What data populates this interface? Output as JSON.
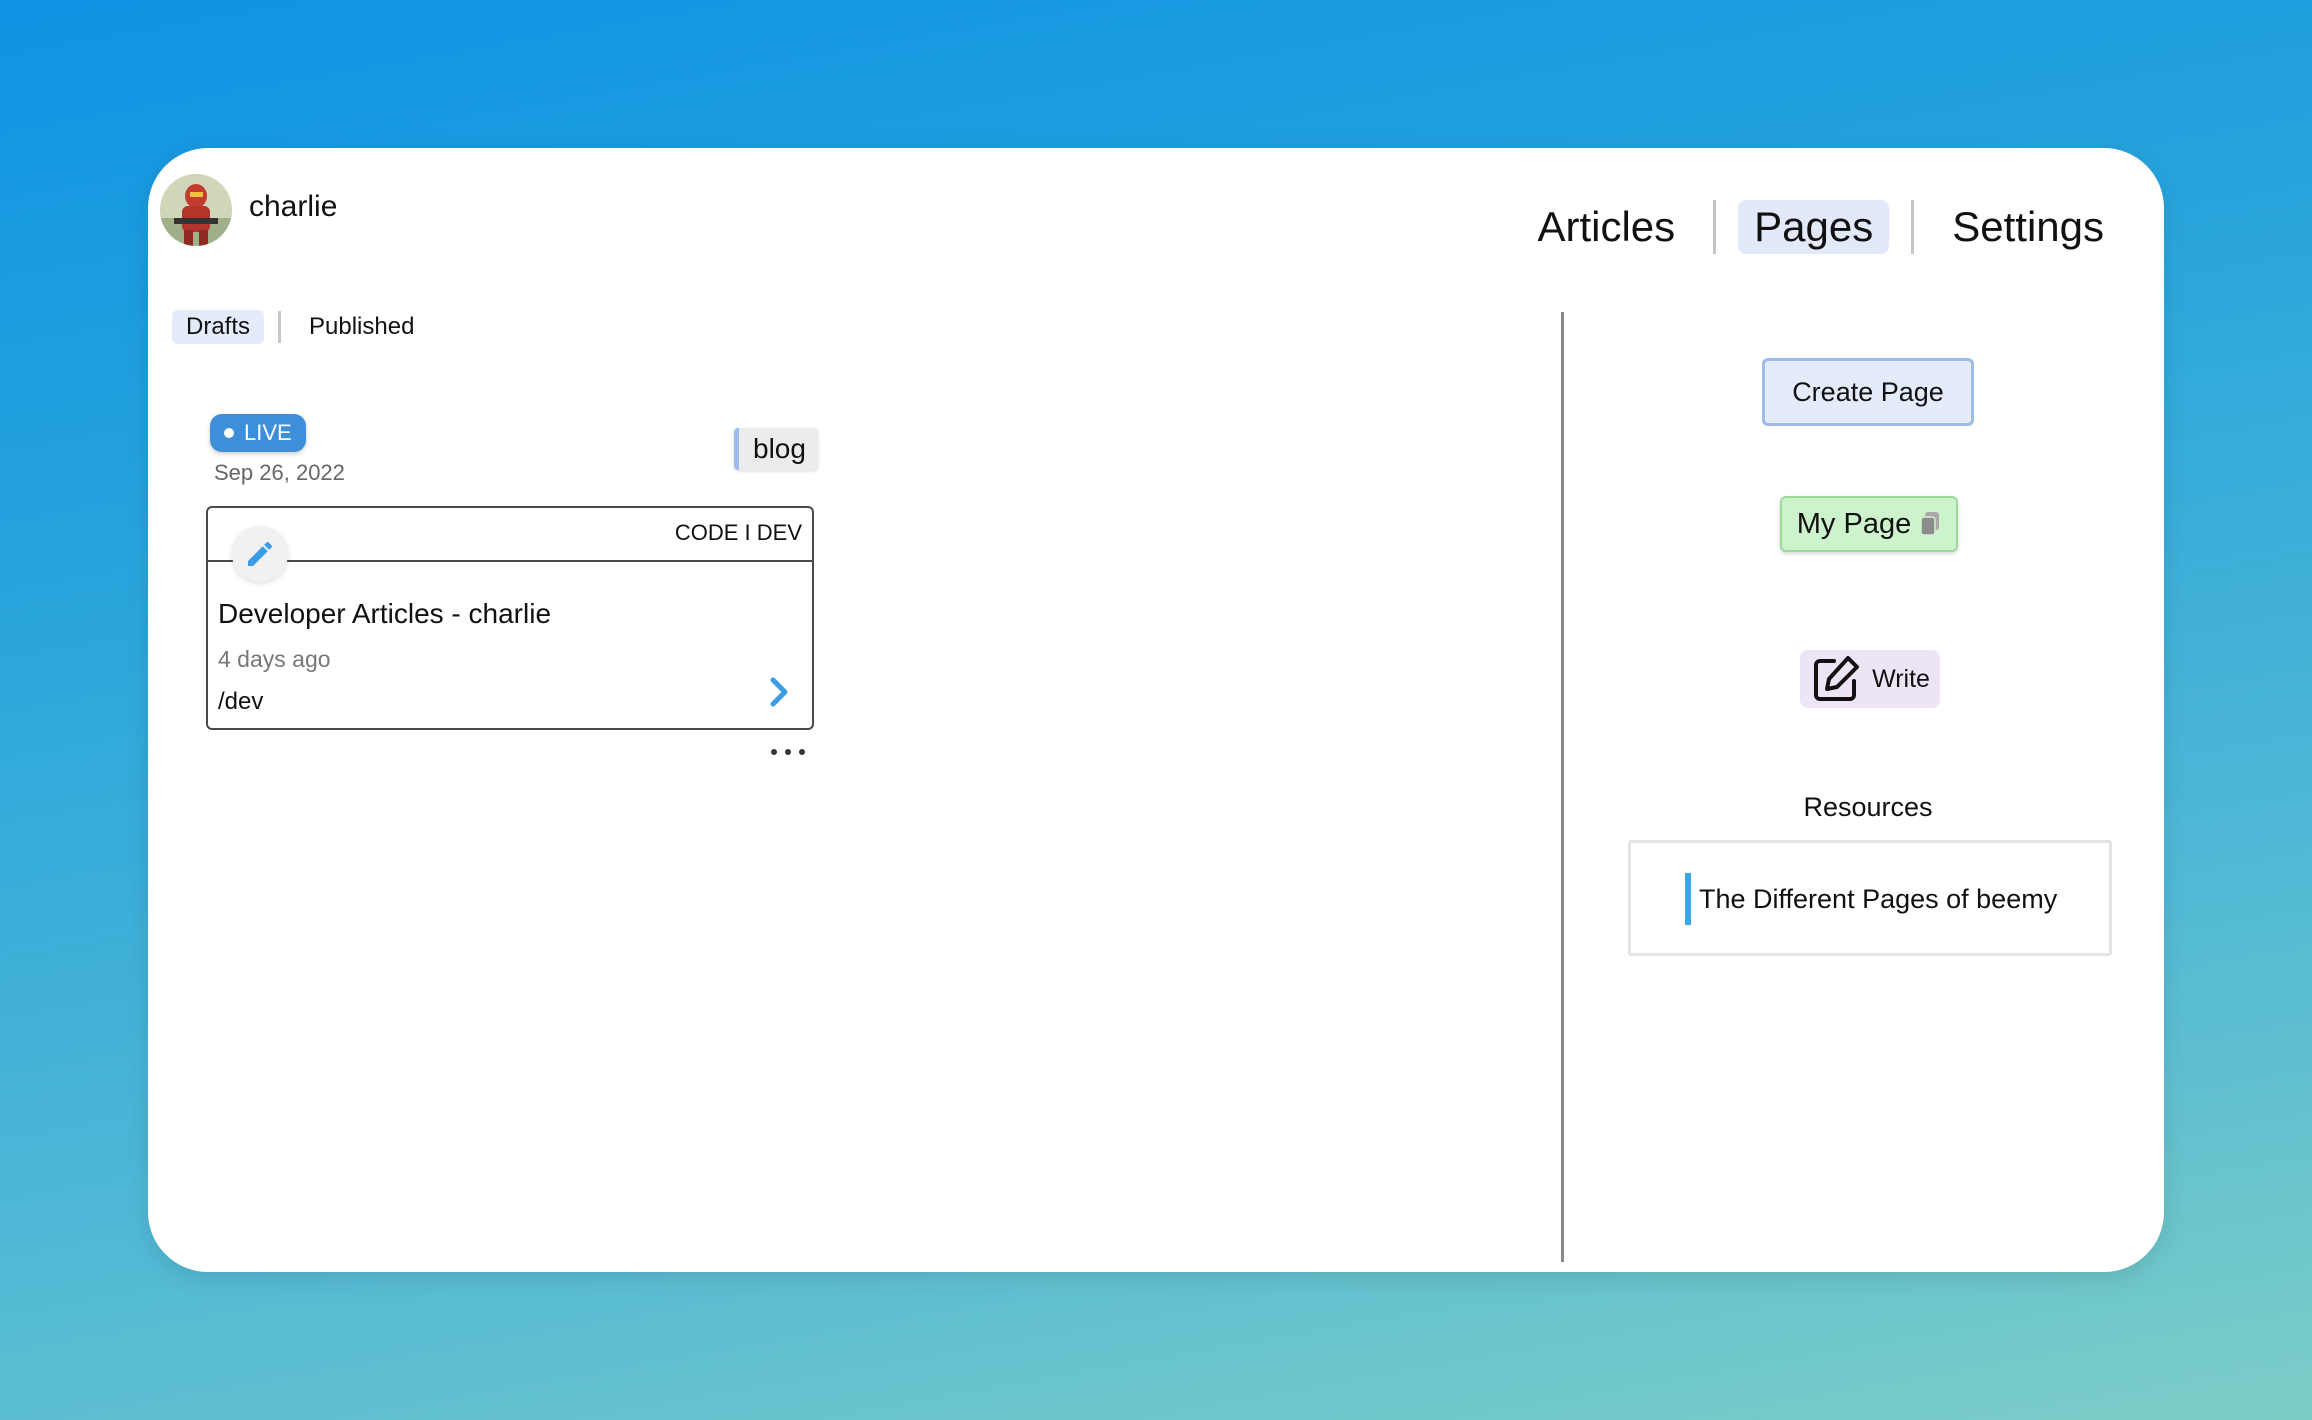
{
  "user": {
    "name": "charlie"
  },
  "nav": {
    "items": [
      "Articles",
      "Pages",
      "Settings"
    ],
    "active": "Pages"
  },
  "subtabs": {
    "items": [
      "Drafts",
      "Published"
    ],
    "active": "Drafts"
  },
  "post": {
    "status": "LIVE",
    "date": "Sep 26, 2022",
    "tag": "blog",
    "header_label": "CODE I DEV",
    "title": "Developer Articles - charlie",
    "time_ago": "4 days ago",
    "path": "/dev"
  },
  "sidebar": {
    "create_label": "Create Page",
    "my_page_label": "My Page",
    "write_label": "Write",
    "resources_title": "Resources",
    "resources": [
      "The Different Pages of beemy"
    ]
  },
  "colors": {
    "accent_blue": "#3e8fd9",
    "nav_active_bg": "#e1e9fb",
    "my_page_bg": "#cdf3cc",
    "write_bg": "#ede4f6",
    "resource_border": "#3aa6e8"
  },
  "icons": {
    "avatar": "avatar-image",
    "edit": "pencil-icon",
    "arrow": "chevron-right-icon",
    "more": "ellipsis-icon",
    "copy": "copy-icon",
    "write": "edit-square-icon"
  }
}
